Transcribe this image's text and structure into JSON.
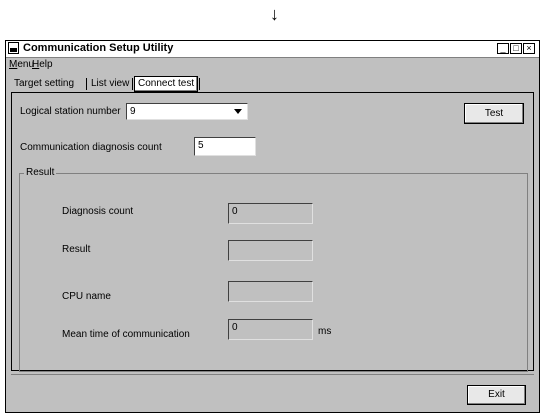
{
  "annotation_arrow": "↓",
  "window": {
    "title": "Communication Setup Utility",
    "controls": {
      "minimize": "_",
      "maximize": "□",
      "close": "×"
    }
  },
  "menu": [
    {
      "label": "Menu",
      "accel": "M",
      "rest": "enu"
    },
    {
      "label": "Help",
      "accel": "H",
      "rest": "elp"
    }
  ],
  "tabs": [
    "Target setting",
    "List view",
    "Connect test"
  ],
  "active_tab": "Connect test",
  "form": {
    "logical_station_label": "Logical station number",
    "logical_station_value": "9",
    "diag_count_label": "Communication diagnosis count",
    "diag_count_value": "5",
    "test_button": "Test"
  },
  "result": {
    "group_title": "Result",
    "diagnosis_count_label": "Diagnosis count",
    "diagnosis_count_value": "0",
    "result_label": "Result",
    "result_value": "",
    "cpu_name_label": "CPU name",
    "cpu_name_value": "",
    "mean_time_label": "Mean time of communication",
    "mean_time_value": "0",
    "mean_time_unit": "ms"
  },
  "exit_button": "Exit"
}
